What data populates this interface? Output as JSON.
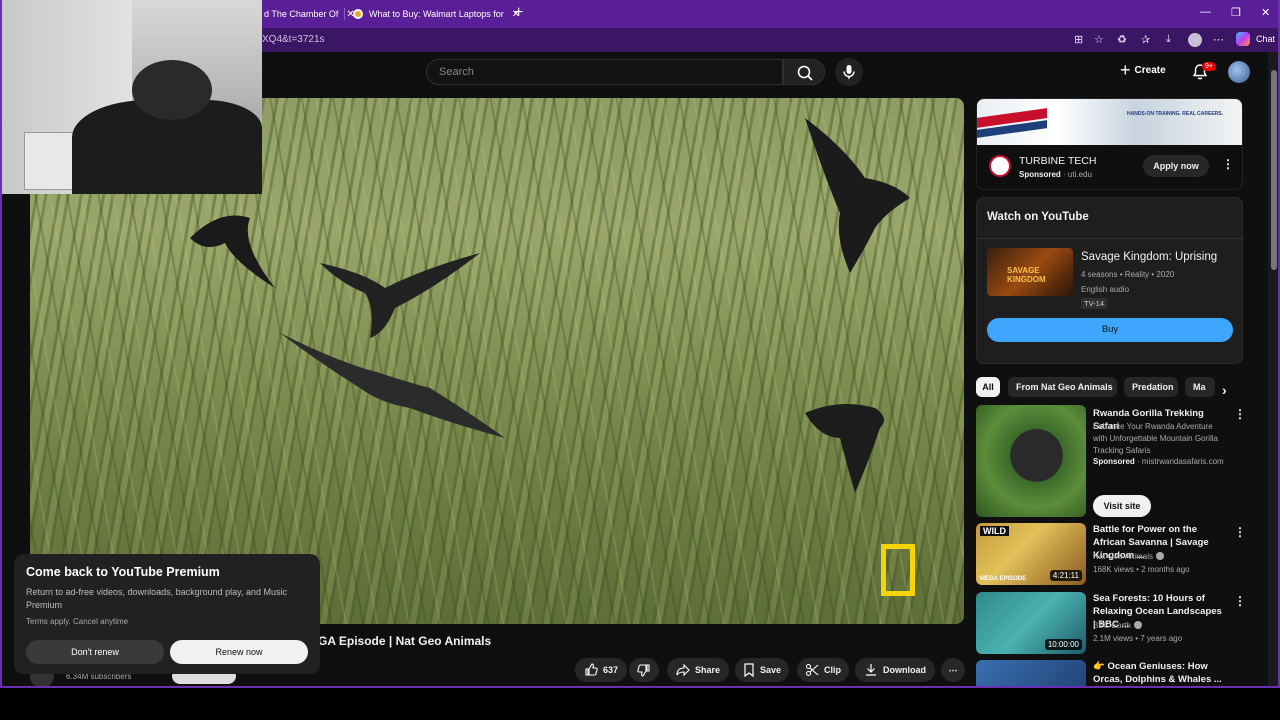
{
  "browser": {
    "tabs": [
      {
        "label": "d The Chamber Of"
      },
      {
        "label": "What to Buy: Walmart Laptops for"
      }
    ],
    "url": "XQ4&t=3721s",
    "chat_label": "Chat"
  },
  "youtube": {
    "search_placeholder": "Search",
    "create_label": "Create",
    "notification_badge": "9+"
  },
  "player": {
    "video_title_visible": "GA Episode | Nat Geo Animals",
    "channel_subscribers": "6.34M subscribers",
    "actions": {
      "likes": "637",
      "share": "Share",
      "save": "Save",
      "clip": "Clip",
      "download": "Download"
    }
  },
  "premium_popup": {
    "title": "Come back to YouTube Premium",
    "description": "Return to ad-free videos, downloads, background play, and Music Premium",
    "terms": "Terms apply. Cancel anytime",
    "dont_renew": "Don't renew",
    "renew_now": "Renew now"
  },
  "ad": {
    "banner_tag": "HANDS-ON TRAINING. REAL CAREERS.",
    "advertiser": "TURBINE TECH",
    "sponsored": "Sponsored",
    "domain": "uti.edu",
    "cta": "Apply now"
  },
  "watch_on_youtube": {
    "heading": "Watch on YouTube",
    "poster_text": "SAVAGE KINGDOM",
    "show_title": "Savage Kingdom: Uprising",
    "meta": "4 seasons • Reality • 2020",
    "audio": "English audio",
    "rating": "TV-14",
    "buy": "Buy"
  },
  "chips": [
    "All",
    "From Nat Geo Animals",
    "Predation",
    "Ma"
  ],
  "recommendations": [
    {
      "title": "Rwanda Gorilla Trekking Safari",
      "description": "Enhance Your Rwanda Adventure with Unforgettable Mountain Gorilla Tracking Safaris",
      "sponsored": "Sponsored",
      "domain": "mistrwandasafaris.com",
      "cta": "Visit site"
    },
    {
      "title": "Battle for Power on the African Savanna | Savage Kingdom ...",
      "channel": "Nat Geo Animals",
      "stats": "168K views • 2 months ago",
      "duration": "4:21:11",
      "badge_top": "WILD",
      "badge_bottom": "MEGA EPISODE"
    },
    {
      "title": "Sea Forests: 10 Hours of Relaxing Ocean Landscapes | BBC ...",
      "channel": "BBC Earth",
      "stats": "2.1M views • 7 years ago",
      "duration": "10:00:00"
    },
    {
      "title": "👉 Ocean Geniuses: How Orcas, Dolphins & Whales ..."
    }
  ],
  "colors": {
    "browser_accent": "#5a1e96",
    "youtube_bg": "#0f0f0f",
    "buy_button": "#3ea6ff",
    "natgeo_yellow": "#f5d50a"
  }
}
